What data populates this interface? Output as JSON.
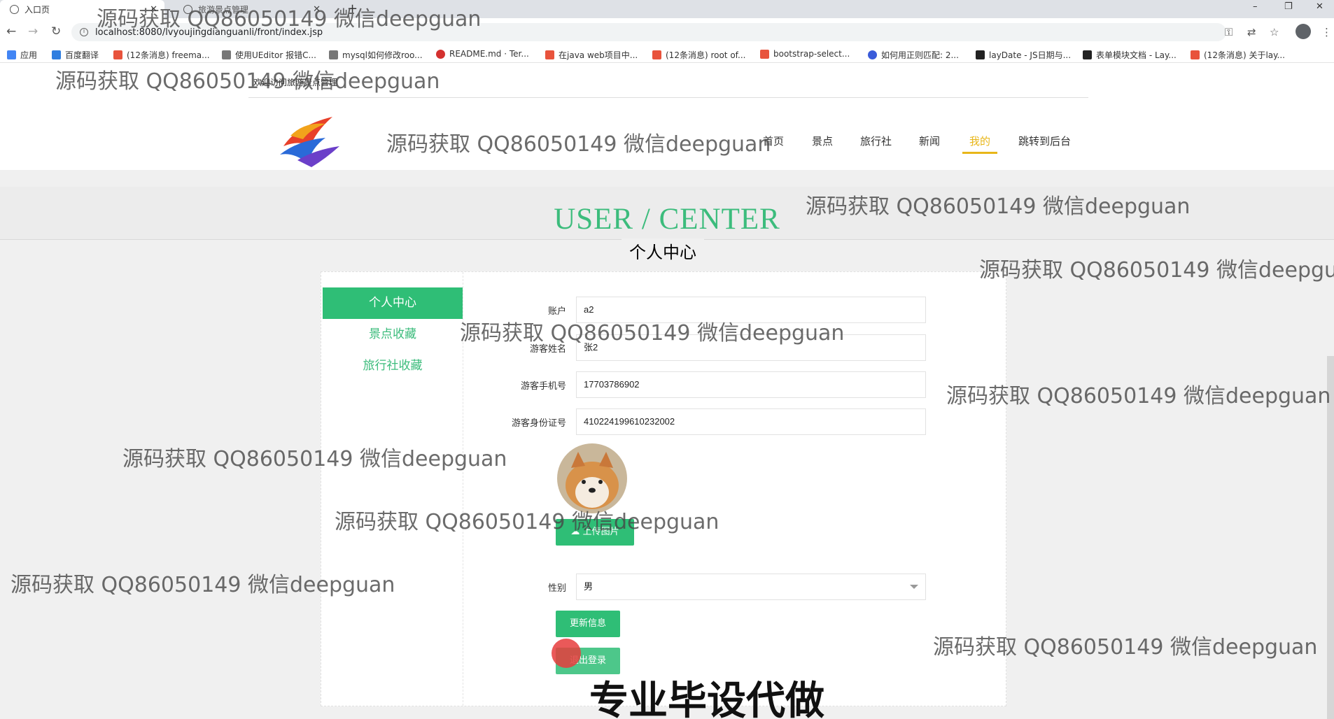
{
  "browser": {
    "tabs": [
      {
        "title": "入口页",
        "active": true
      },
      {
        "title": "旅游景点管理",
        "active": false
      }
    ],
    "url": "localhost:8080/lvyoujingdianguanli/front/index.jsp",
    "bookmarks": [
      {
        "label": "应用",
        "color": "#4285f4"
      },
      {
        "label": "百度翻译",
        "color": "#2f7ee0"
      },
      {
        "label": "(12条消息) freema...",
        "color": "#e8533c"
      },
      {
        "label": "使用UEditor 报错C...",
        "color": "#555555"
      },
      {
        "label": "mysql如何修改roo...",
        "color": "#555555"
      },
      {
        "label": "README.md · Ter...",
        "color": "#d4312f"
      },
      {
        "label": "在java web项目中...",
        "color": "#e8533c"
      },
      {
        "label": "(12条消息) root of...",
        "color": "#e8533c"
      },
      {
        "label": "bootstrap-select...",
        "color": "#e8533c"
      },
      {
        "label": "如何用正则匹配: 2...",
        "color": "#3a5bd9"
      },
      {
        "label": "layDate - JS日期与...",
        "color": "#222222"
      },
      {
        "label": "表单模块文档 - Lay...",
        "color": "#222222"
      },
      {
        "label": "(12条消息) 关于lay...",
        "color": "#e8533c"
      }
    ]
  },
  "header": {
    "welcome": "欢迎访问旅游景点管理",
    "nav": [
      "首页",
      "景点",
      "旅行社",
      "新闻",
      "我的",
      "跳转到后台"
    ],
    "active_nav": "我的"
  },
  "center": {
    "title_en": "USER / CENTER",
    "title_cn": "个人中心"
  },
  "sidebar": {
    "items": [
      "个人中心",
      "景点收藏",
      "旅行社收藏"
    ]
  },
  "form": {
    "account_label": "账户",
    "account_value": "a2",
    "name_label": "游客姓名",
    "name_value": "张2",
    "phone_label": "游客手机号",
    "phone_value": "17703786902",
    "idcard_label": "游客身份证号",
    "idcard_value": "410224199610232002",
    "upload_label": "上传图片",
    "gender_label": "性别",
    "gender_value": "男",
    "update_label": "更新信息",
    "logout_label": "退出登录"
  },
  "colors": {
    "accent_green": "#2fbe76",
    "title_green": "#3cbc7c",
    "nav_active": "#e8b619"
  },
  "overlay": {
    "watermark": "源码获取 QQ86050149 微信deepguan",
    "watermark_cut": "源码获取 QQ86050149 微信deepgua",
    "big_text": "专业毕设代做"
  }
}
